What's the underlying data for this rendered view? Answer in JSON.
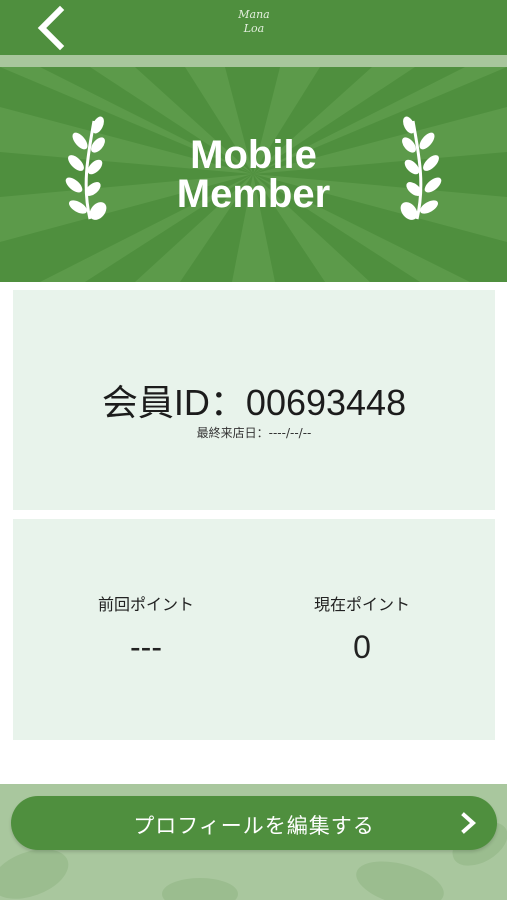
{
  "header": {
    "logo_line1": "Mana",
    "logo_line2": "Loa"
  },
  "banner": {
    "title_line1": "Mobile",
    "title_line2": "Member"
  },
  "member": {
    "id_label": "会員ID：",
    "id_value": "00693448",
    "last_visit_label": "最終来店日：",
    "last_visit_value": "----/--/--"
  },
  "points": {
    "previous_label": "前回ポイント",
    "previous_value": "---",
    "current_label": "現在ポイント",
    "current_value": "0"
  },
  "footer": {
    "edit_profile_label": "プロフィールを編集する"
  },
  "colors": {
    "brand_green": "#4f8f3e",
    "light_green": "#a8c69c",
    "card_bg": "#e8f3eb"
  },
  "icons": [
    "back-chevron-icon",
    "laurel-left-icon",
    "laurel-right-icon",
    "chevron-right-icon"
  ]
}
